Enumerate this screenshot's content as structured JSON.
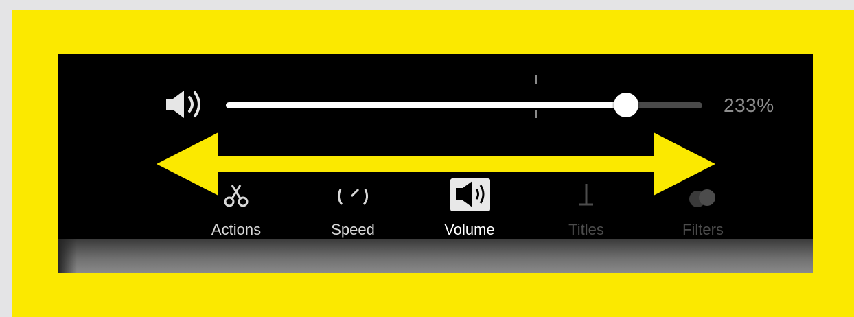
{
  "volume": {
    "percent_label": "233%",
    "level_fraction": 0.84,
    "marker_fraction": 0.65
  },
  "toolbar": {
    "items": [
      {
        "label": "Actions",
        "icon": "scissors-icon",
        "state": "normal"
      },
      {
        "label": "Speed",
        "icon": "speedometer-icon",
        "state": "normal"
      },
      {
        "label": "Volume",
        "icon": "speaker-icon",
        "state": "active"
      },
      {
        "label": "Titles",
        "icon": "text-cursor-icon",
        "state": "disabled"
      },
      {
        "label": "Filters",
        "icon": "overlap-circles-icon",
        "state": "disabled"
      }
    ]
  },
  "colors": {
    "frame": "#fbe900",
    "annotation_arrow": "#fbe900",
    "panel": "#000000"
  },
  "annotation": {
    "icon": "double-headed-arrow-icon"
  }
}
